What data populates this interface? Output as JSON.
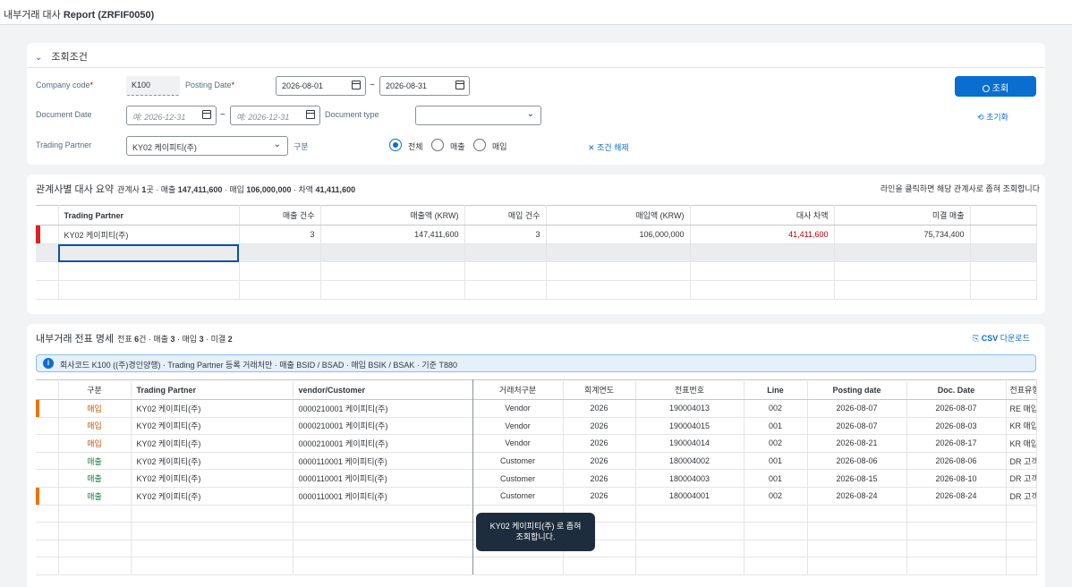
{
  "app": {
    "title_prefix": "내부거래 대사 ",
    "title_bold": "Report (ZRFIF0050)"
  },
  "filter": {
    "title": "조회조건",
    "company_code_label": "Company code",
    "company_code_value": "K100",
    "posting_date_label": "Posting Date",
    "posting_date_from": "2026-08-01",
    "posting_date_to": "2026-08-31",
    "document_date_label": "Document Date",
    "document_date_from_ph": "예: 2026-12-31",
    "document_date_to_ph": "예: 2026-12-31",
    "document_type_label": "Document type",
    "document_type_value": "",
    "trading_partner_label": "Trading Partner",
    "trading_partner_value": "KY02 케이피티(주)",
    "gubun_label": "구분",
    "radio_all": "전체",
    "radio_sales": "매출",
    "radio_purchase": "매입",
    "clear_label": "조건 해제",
    "search_label": "조회",
    "reset_label": "초기화",
    "tilde": "~"
  },
  "summary": {
    "title": "관계사별 대사 요약",
    "sub_p1": "관계사 ",
    "sub_b1": "1",
    "sub_p2": "곳 · 매출 ",
    "sub_b2": "147,411,600",
    "sub_p3": " · 매입 ",
    "sub_b3": "106,000,000",
    "sub_p4": " · 차액 ",
    "sub_b4": "41,411,600",
    "hint": "라인을 클릭하면 해당 관계사로 좁혀 조회합니다",
    "columns": [
      "Trading Partner",
      "매출 건수",
      "매출액 (KRW)",
      "매입 건수",
      "매입액 (KRW)",
      "대사 차액",
      "미결 매출"
    ],
    "rows": [
      {
        "partner": "KY02 케이피티(주)",
        "sales_count": "3",
        "sales_amount": "147,411,600",
        "purchase_count": "3",
        "purchase_amount": "106,000,000",
        "diff": "41,411,600",
        "open_sales": "75,734,400"
      }
    ]
  },
  "detail": {
    "title": "내부거래 전표 명세",
    "sub_p1": "전표 ",
    "sub_b1": "6",
    "sub_p2": "건 · 매출 ",
    "sub_b2": "3",
    "sub_p3": " · 매입 ",
    "sub_b3": "3",
    "sub_p4": " · 미결 ",
    "sub_b4": "2",
    "csv_label_b": "CSV",
    "csv_label": " 다운로드",
    "info_text": "회사코드 K100 ((주)경인양행) · Trading Partner 등록 거래처만 · 매출 BSID / BSAD · 매입 BSIK / BSAK · 기준 T880",
    "columns": [
      "구분",
      "Trading Partner",
      "vendor/Customer",
      "거래처구분",
      "회계연도",
      "전표번호",
      "Line",
      "Posting date",
      "Doc. Date",
      "전표유형"
    ],
    "rows": [
      {
        "type": "매입",
        "partner": "KY02 케이피티(주)",
        "vc": "0000210001 케이피티(주)",
        "kind": "Vendor",
        "year": "2026",
        "doc": "190004013",
        "line": "002",
        "pdate": "2026-08-07",
        "ddate": "2026-08-07",
        "dtype": "RE 매입"
      },
      {
        "type": "매입",
        "partner": "KY02 케이피티(주)",
        "vc": "0000210001 케이피티(주)",
        "kind": "Vendor",
        "year": "2026",
        "doc": "190004015",
        "line": "001",
        "pdate": "2026-08-07",
        "ddate": "2026-08-03",
        "dtype": "KR 매입"
      },
      {
        "type": "매입",
        "partner": "KY02 케이피티(주)",
        "vc": "0000210001 케이피티(주)",
        "kind": "Vendor",
        "year": "2026",
        "doc": "190004014",
        "line": "002",
        "pdate": "2026-08-21",
        "ddate": "2026-08-17",
        "dtype": "KR 매입"
      },
      {
        "type": "매출",
        "partner": "KY02 케이피티(주)",
        "vc": "0000110001 케이피티(주)",
        "kind": "Customer",
        "year": "2026",
        "doc": "180004002",
        "line": "001",
        "pdate": "2026-08-06",
        "ddate": "2026-08-06",
        "dtype": "DR 고객"
      },
      {
        "type": "매출",
        "partner": "KY02 케이피티(주)",
        "vc": "0000110001 케이피티(주)",
        "kind": "Customer",
        "year": "2026",
        "doc": "180004003",
        "line": "001",
        "pdate": "2026-08-15",
        "ddate": "2026-08-10",
        "dtype": "DR 고객"
      },
      {
        "type": "매출",
        "partner": "KY02 케이피티(주)",
        "vc": "0000110001 케이피티(주)",
        "kind": "Customer",
        "year": "2026",
        "doc": "180004001",
        "line": "002",
        "pdate": "2026-08-24",
        "ddate": "2026-08-24",
        "dtype": "DR 고객"
      }
    ]
  },
  "tooltip": {
    "line1": "KY02 케이피티(주) 로 좁혀",
    "line2": "조회합니다."
  },
  "colors": {
    "accent": "#0a6ed1",
    "negative": "#bb0000",
    "purchase": "#c35500",
    "sales": "#107e3e",
    "marker_red": "#e02020",
    "marker_orange": "#e9730c"
  }
}
